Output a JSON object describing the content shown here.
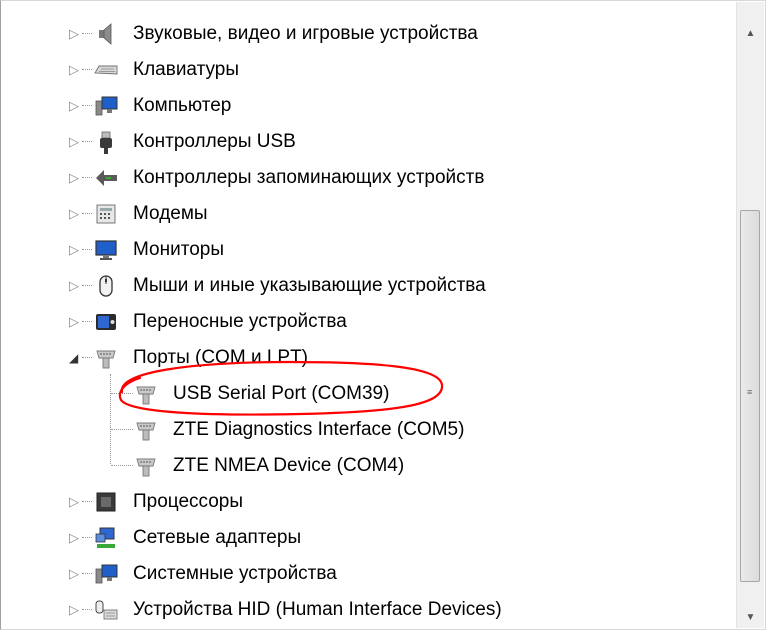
{
  "tree": {
    "items": [
      {
        "label": "Звуковые, видео и игровые устройства",
        "icon": "speaker-icon",
        "expander": "▷"
      },
      {
        "label": "Клавиатуры",
        "icon": "keyboard-icon",
        "expander": "▷"
      },
      {
        "label": "Компьютер",
        "icon": "computer-icon",
        "expander": "▷"
      },
      {
        "label": "Контроллеры USB",
        "icon": "usb-icon",
        "expander": "▷"
      },
      {
        "label": "Контроллеры запоминающих устройств",
        "icon": "storage-controller-icon",
        "expander": "▷"
      },
      {
        "label": "Модемы",
        "icon": "modem-icon",
        "expander": "▷"
      },
      {
        "label": "Мониторы",
        "icon": "monitor-icon",
        "expander": "▷"
      },
      {
        "label": "Мыши и иные указывающие устройства",
        "icon": "mouse-icon",
        "expander": "▷"
      },
      {
        "label": "Переносные устройства",
        "icon": "portable-device-icon",
        "expander": "▷"
      },
      {
        "label": "Порты (COM и LPT)",
        "icon": "port-icon",
        "expander": "◢"
      },
      {
        "label": "USB Serial Port (COM39)",
        "icon": "port-icon",
        "child": true
      },
      {
        "label": "ZTE Diagnostics Interface (COM5)",
        "icon": "port-icon",
        "child": true
      },
      {
        "label": "ZTE NMEA Device (COM4)",
        "icon": "port-icon",
        "child": true
      },
      {
        "label": "Процессоры",
        "icon": "processor-icon",
        "expander": "▷"
      },
      {
        "label": "Сетевые адаптеры",
        "icon": "network-adapter-icon",
        "expander": "▷"
      },
      {
        "label": "Системные устройства",
        "icon": "system-devices-icon",
        "expander": "▷"
      },
      {
        "label": "Устройства HID (Human Interface Devices)",
        "icon": "hid-icon",
        "expander": "▷"
      }
    ]
  },
  "annotation": {
    "color": "#ff0000",
    "target": "USB Serial Port (COM39)"
  },
  "scrollbar": {
    "up_glyph": "▲",
    "down_glyph": "▼",
    "grip_glyph": "≡"
  }
}
